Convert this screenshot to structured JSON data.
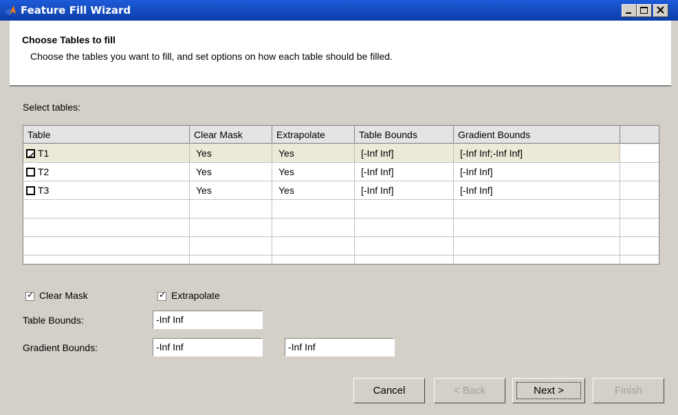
{
  "window": {
    "title": "Feature Fill Wizard",
    "controls": [
      "minimize",
      "maximize",
      "close"
    ]
  },
  "header": {
    "title": "Choose Tables to fill",
    "subtitle": "Choose the tables you want to fill, and set options on how each table should be filled."
  },
  "select_label": "Select tables:",
  "table": {
    "columns": [
      "Table",
      "Clear Mask",
      "Extrapolate",
      "Table Bounds",
      "Gradient Bounds",
      ""
    ],
    "rows": [
      {
        "checked": true,
        "name": "T1",
        "clear_mask": "Yes",
        "extrapolate": "Yes",
        "table_bounds": "[-Inf Inf]",
        "gradient_bounds": "[-Inf Inf;-Inf Inf]"
      },
      {
        "checked": false,
        "name": "T2",
        "clear_mask": "Yes",
        "extrapolate": "Yes",
        "table_bounds": "[-Inf Inf]",
        "gradient_bounds": "[-Inf Inf]"
      },
      {
        "checked": false,
        "name": "T3",
        "clear_mask": "Yes",
        "extrapolate": "Yes",
        "table_bounds": "[-Inf Inf]",
        "gradient_bounds": "[-Inf Inf]"
      }
    ]
  },
  "options": {
    "clear_mask": {
      "label": "Clear Mask",
      "checked": true
    },
    "extrapolate": {
      "label": "Extrapolate",
      "checked": true
    },
    "table_bounds_label": "Table Bounds:",
    "table_bounds_value": "-Inf Inf",
    "gradient_bounds_label": "Gradient Bounds:",
    "gradient_bounds_value_1": "-Inf Inf",
    "gradient_bounds_value_2": "-Inf Inf"
  },
  "buttons": {
    "cancel": "Cancel",
    "back": "< Back",
    "next": "Next >",
    "finish": "Finish"
  },
  "colors": {
    "titlebar": "#0a3ea8",
    "dialog_bg": "#d4d0c8",
    "selected_row": "#ece9d8"
  }
}
